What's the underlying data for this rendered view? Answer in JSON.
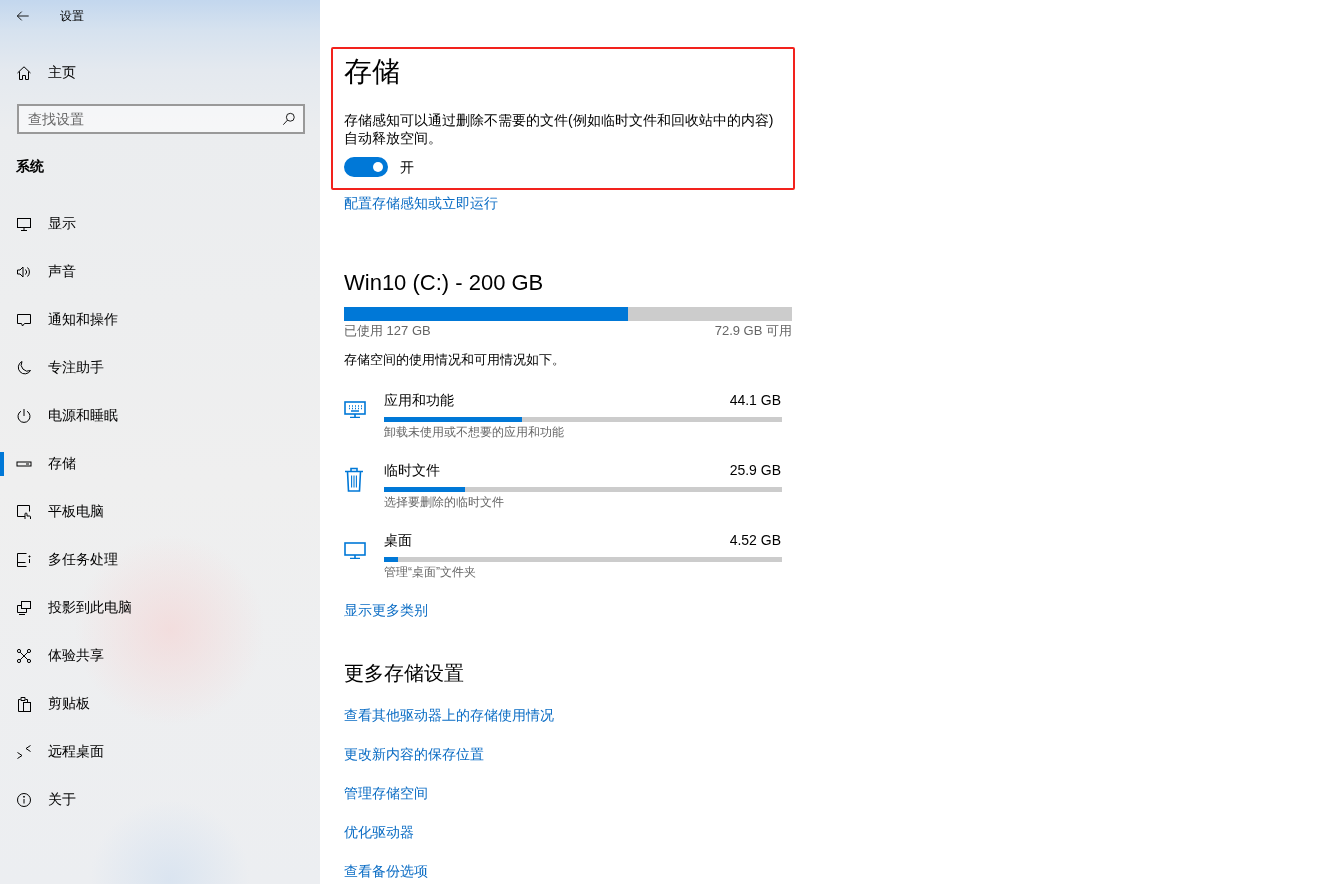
{
  "window": {
    "title": "设置"
  },
  "sidebar": {
    "home": "主页",
    "search": {
      "placeholder": "查找设置"
    },
    "section": "系统",
    "items": [
      {
        "label": "显示",
        "selected": false
      },
      {
        "label": "声音",
        "selected": false
      },
      {
        "label": "通知和操作",
        "selected": false
      },
      {
        "label": "专注助手",
        "selected": false
      },
      {
        "label": "电源和睡眠",
        "selected": false
      },
      {
        "label": "存储",
        "selected": true
      },
      {
        "label": "平板电脑",
        "selected": false
      },
      {
        "label": "多任务处理",
        "selected": false
      },
      {
        "label": "投影到此电脑",
        "selected": false
      },
      {
        "label": "体验共享",
        "selected": false
      },
      {
        "label": "剪贴板",
        "selected": false
      },
      {
        "label": "远程桌面",
        "selected": false
      },
      {
        "label": "关于",
        "selected": false
      }
    ]
  },
  "storage_sense": {
    "title": "存储",
    "highlighted": true,
    "description": "存储感知可以通过删除不需要的文件(例如临时文件和回收站中的内容)自动释放空间。",
    "toggle": {
      "on": true,
      "label": "开"
    },
    "link": "配置存储感知或立即运行"
  },
  "drive": {
    "title": "Win10 (C:) - 200 GB",
    "level": 0.635,
    "used": "已使用 127 GB",
    "free": "72.9 GB 可用",
    "summary": "存储空间的使用情况和可用情况如下。",
    "categories": [
      {
        "name": "应用和功能",
        "size": "44.1 GB",
        "level": 0.347,
        "hint": "卸载未使用或不想要的应用和功能"
      },
      {
        "name": "临时文件",
        "size": "25.9 GB",
        "level": 0.204,
        "hint": "选择要删除的临时文件"
      },
      {
        "name": "桌面",
        "size": "4.52 GB",
        "level": 0.036,
        "hint": "管理“桌面”文件夹"
      }
    ],
    "more_link": "显示更多类别"
  },
  "more_settings": {
    "title": "更多存储设置",
    "links": [
      "查看其他驱动器上的存储使用情况",
      "更改新内容的保存位置",
      "管理存储空间",
      "优化驱动器",
      "查看备份选项"
    ]
  }
}
